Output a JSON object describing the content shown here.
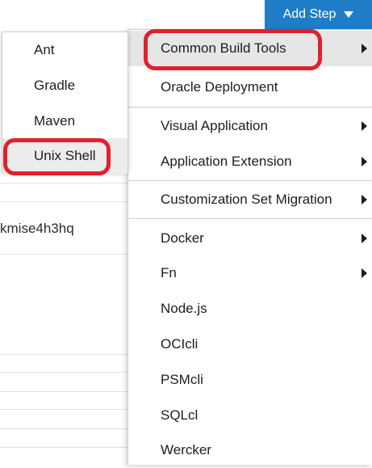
{
  "header": {
    "add_step_label": "Add Step",
    "caret_icon": "caret-down-icon",
    "button_color": "#1f7dc7"
  },
  "background": {
    "partial_id_text": "kmise4h3hq"
  },
  "menu": {
    "items": [
      {
        "label": "Common Build Tools",
        "has_submenu": true
      },
      {
        "label": "Oracle Deployment",
        "has_submenu": false
      },
      {
        "label": "Visual Application",
        "has_submenu": true
      },
      {
        "label": "Application Extension",
        "has_submenu": true
      },
      {
        "label": "Customization Set Migration",
        "has_submenu": true
      },
      {
        "label": "Docker",
        "has_submenu": true
      },
      {
        "label": "Fn",
        "has_submenu": true
      },
      {
        "label": "Node.js",
        "has_submenu": false
      },
      {
        "label": "OCIcli",
        "has_submenu": false
      },
      {
        "label": "PSMcli",
        "has_submenu": false
      },
      {
        "label": "SQLcl",
        "has_submenu": false
      },
      {
        "label": "Wercker",
        "has_submenu": false
      }
    ]
  },
  "submenu": {
    "items": [
      {
        "label": "Ant"
      },
      {
        "label": "Gradle"
      },
      {
        "label": "Maven"
      },
      {
        "label": "Unix Shell"
      }
    ]
  },
  "highlight_color": "#e0212b"
}
